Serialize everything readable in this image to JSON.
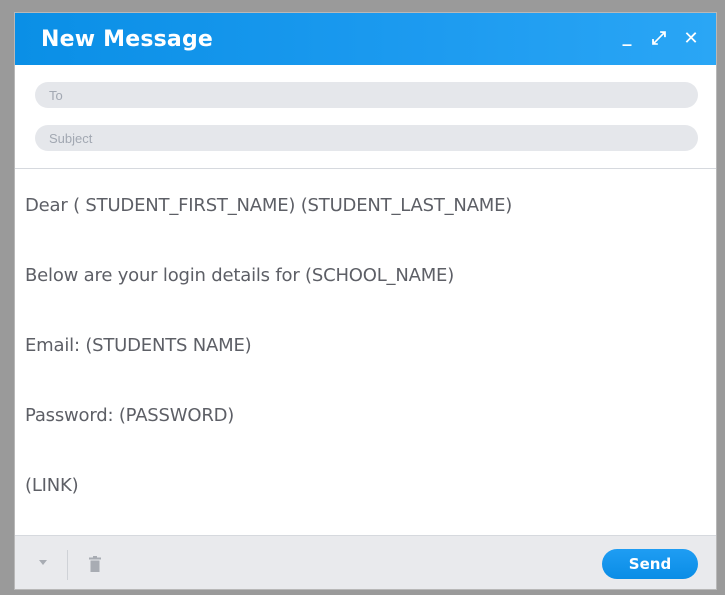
{
  "window": {
    "title": "New Message",
    "controls": {
      "minimize_glyph": "_",
      "maximize_glyph": "⤢",
      "close_glyph": "✕"
    }
  },
  "fields": {
    "to_placeholder": "To",
    "to_value": "",
    "subject_placeholder": "Subject",
    "subject_value": ""
  },
  "body": {
    "lines": [
      "Dear ( STUDENT_FIRST_NAME) (STUDENT_LAST_NAME)",
      "Below are your login details for (SCHOOL_NAME)",
      "Email: (STUDENTS NAME)",
      "Password: (PASSWORD)",
      "(LINK)"
    ]
  },
  "footer": {
    "send_label": "Send"
  },
  "colors": {
    "accent": "#1d9bf0",
    "field_bg": "#e5e7eb",
    "footer_bg": "#e9eaed",
    "body_text": "#5d5f66"
  },
  "icons": {
    "options": "chevron-down-icon",
    "delete": "trash-icon",
    "minimize": "minimize-icon",
    "maximize": "expand-icon",
    "close": "close-icon"
  }
}
